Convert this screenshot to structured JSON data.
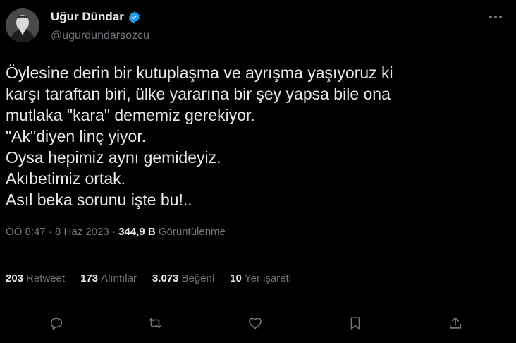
{
  "user": {
    "display_name": "Uğur Dündar",
    "handle": "@ugurdundarsozcu",
    "verified_color": "#1d9bf0"
  },
  "tweet": {
    "text": "Öylesine derin bir kutuplaşma ve ayrışma yaşıyoruz ki\nkarşı taraftan biri, ülke yararına bir şey yapsa bile ona\nmutlaka \"kara\" dememiz gerekiyor.\n\"Ak\"diyen linç yiyor.\nOysa hepimiz aynı gemideyiz.\nAkıbetimiz ortak.\nAsıl beka sorunu işte bu!..",
    "time": "ÖÖ 8:47",
    "date": "8 Haz 2023",
    "views_count": "344,9 B",
    "views_label": "Görüntülenme"
  },
  "stats": {
    "retweets": {
      "count": "203",
      "label": "Retweet"
    },
    "quotes": {
      "count": "173",
      "label": "Alıntılar"
    },
    "likes": {
      "count": "3.073",
      "label": "Beğeni"
    },
    "bookmarks": {
      "count": "10",
      "label": "Yer işareti"
    }
  },
  "icons": {
    "more": "more-horizontal-icon",
    "reply": "reply-icon",
    "retweet": "retweet-icon",
    "like": "heart-icon",
    "bookmark": "bookmark-icon",
    "share": "share-icon"
  },
  "colors": {
    "background": "#000000",
    "text": "#e7e9ea",
    "secondary": "#71767b",
    "divider": "#2f3336"
  }
}
